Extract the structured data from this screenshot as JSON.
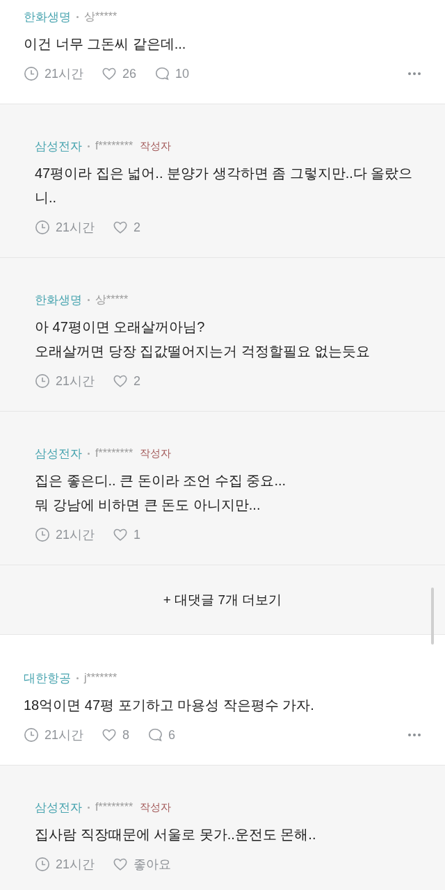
{
  "items": [
    {
      "kind": "comment",
      "company": "한화생명",
      "user": "상*****",
      "body": "이건 너무 그돈씨 같은데...",
      "time": "21시간",
      "likes": "26",
      "replies": "10",
      "menu": true
    },
    {
      "kind": "reply",
      "company": "삼성전자",
      "user": "f********",
      "badge": "작성자",
      "body": "47평이라 집은 넓어.. 분양가 생각하면 좀 그렇지만..다 올랐으니..",
      "time": "21시간",
      "likes": "2"
    },
    {
      "kind": "reply",
      "company": "한화생명",
      "user": "상*****",
      "body": "아 47평이면 오래살꺼아님?\n오래살꺼면 당장 집값떨어지는거 걱정할필요 없는듯요",
      "time": "21시간",
      "likes": "2"
    },
    {
      "kind": "reply",
      "company": "삼성전자",
      "user": "f********",
      "badge": "작성자",
      "body": "집은 좋은디.. 큰 돈이라 조언 수집 중요...\n뭐 강남에 비하면 큰 돈도 아니지만...",
      "time": "21시간",
      "likes": "1"
    },
    {
      "kind": "more",
      "label": "+ 대댓글 7개 더보기"
    },
    {
      "kind": "comment",
      "company": "대한항공",
      "user": "j*******",
      "body": "18억이면 47평 포기하고 마용성 작은평수 가자.",
      "time": "21시간",
      "likes": "8",
      "replies": "6",
      "menu": true
    },
    {
      "kind": "reply",
      "company": "삼성전자",
      "user": "f********",
      "badge": "작성자",
      "body": "집사람 직장때문에 서울로 못가..운전도 몬해..",
      "time": "21시간",
      "likes": "좋아요"
    }
  ]
}
